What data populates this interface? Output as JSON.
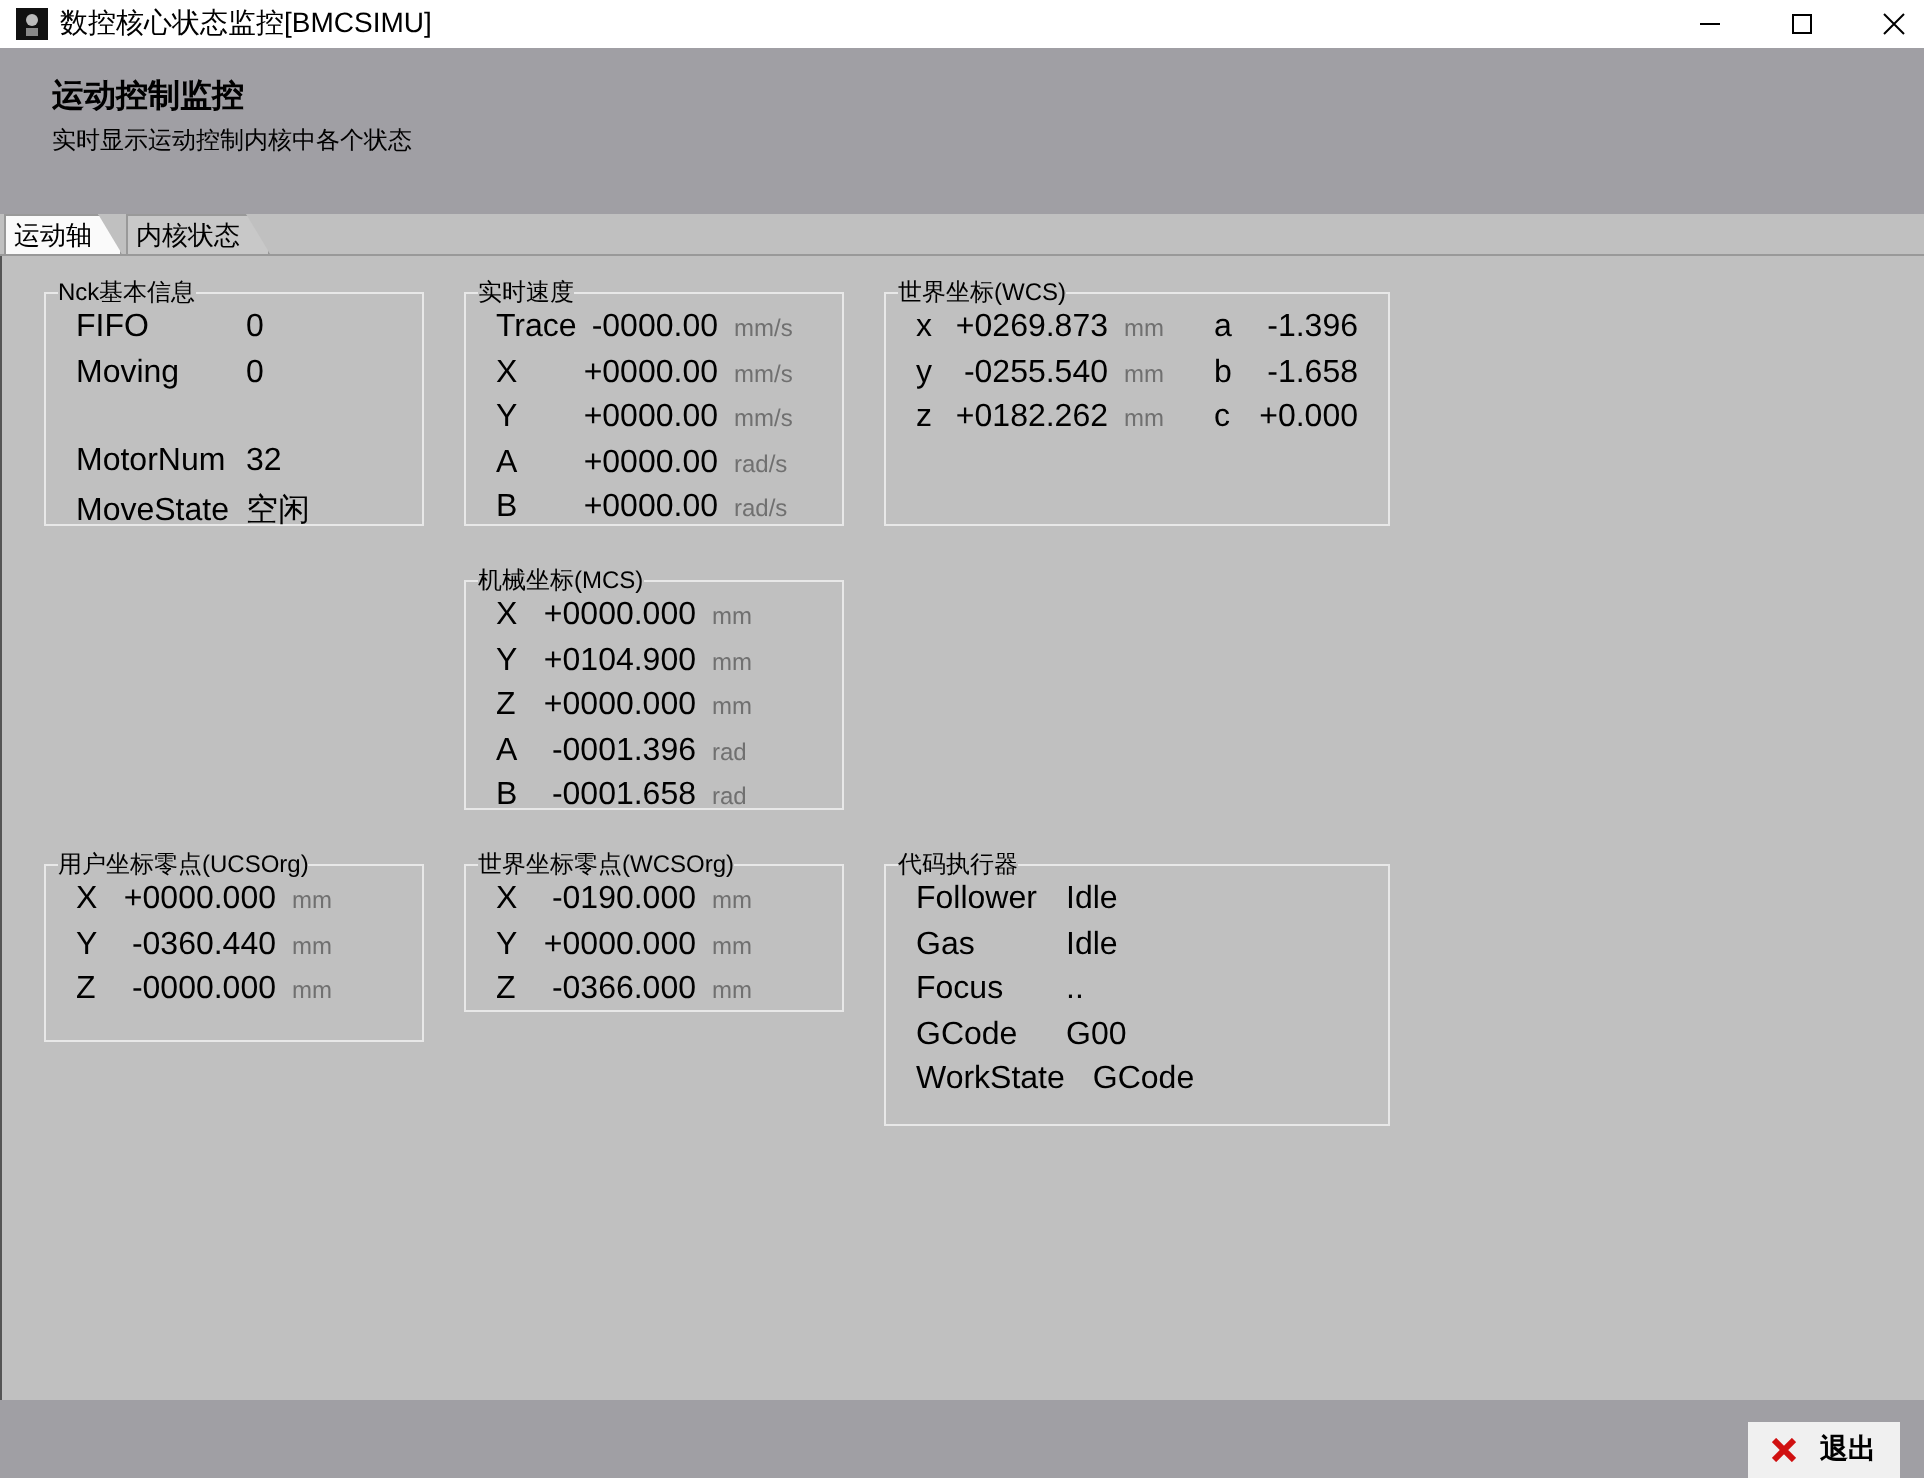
{
  "window": {
    "title": "数控核心状态监控[BMCSIMU]"
  },
  "header": {
    "title": "运动控制监控",
    "subtitle": "实时显示运动控制内核中各个状态"
  },
  "tabs": [
    {
      "label": "运动轴",
      "selected": true
    },
    {
      "label": "内核状态",
      "selected": false
    }
  ],
  "panels": [
    {
      "title": "Nck基本信息",
      "kind": "info",
      "rows": [
        {
          "label": "FIFO",
          "value": "0"
        },
        {
          "label": "Moving",
          "value": "0"
        }
      ],
      "rows_2": [
        {
          "label": "MotorNum",
          "value": "32"
        },
        {
          "label": "MoveState",
          "value": "空闲"
        }
      ]
    },
    {
      "title": "实时速度",
      "kind": "speed",
      "rows": [
        {
          "label": "Trace",
          "value": "-0000.00",
          "unit": "mm/s"
        },
        {
          "label": "X",
          "value": "+0000.00",
          "unit": "mm/s"
        },
        {
          "label": "Y",
          "value": "+0000.00",
          "unit": "mm/s"
        },
        {
          "label": "A",
          "value": "+0000.00",
          "unit": "rad/s"
        },
        {
          "label": "B",
          "value": "+0000.00",
          "unit": "rad/s"
        }
      ]
    },
    {
      "title": "世界坐标(WCS)",
      "kind": "dual",
      "rows": [
        {
          "label": "x",
          "value": "+0269.873",
          "unit": "mm",
          "label_2": "a",
          "value_2": "-1.396"
        },
        {
          "label": "y",
          "value": "-0255.540",
          "unit": "mm",
          "label_2": "b",
          "value_2": "-1.658"
        },
        {
          "label": "z",
          "value": "+0182.262",
          "unit": "mm",
          "label_2": "c",
          "value_2": "+0.000"
        }
      ]
    },
    {
      "title": "机械坐标(MCS)",
      "kind": "coord",
      "rows": [
        {
          "label": "X",
          "value": "+0000.000",
          "unit": "mm"
        },
        {
          "label": "Y",
          "value": "+0104.900",
          "unit": "mm"
        },
        {
          "label": "Z",
          "value": "+0000.000",
          "unit": "mm"
        },
        {
          "label": "A",
          "value": "-0001.396",
          "unit": "rad"
        },
        {
          "label": "B",
          "value": "-0001.658",
          "unit": "rad"
        }
      ]
    },
    {
      "title": "用户坐标零点(UCSOrg)",
      "kind": "coord",
      "rows": [
        {
          "label": "X",
          "value": "+0000.000",
          "unit": "mm"
        },
        {
          "label": "Y",
          "value": "-0360.440",
          "unit": "mm"
        },
        {
          "label": "Z",
          "value": "-0000.000",
          "unit": "mm"
        }
      ]
    },
    {
      "title": "世界坐标零点(WCSOrg)",
      "kind": "coord",
      "rows": [
        {
          "label": "X",
          "value": "-0190.000",
          "unit": "mm"
        },
        {
          "label": "Y",
          "value": "+0000.000",
          "unit": "mm"
        },
        {
          "label": "Z",
          "value": "-0366.000",
          "unit": "mm"
        }
      ]
    },
    {
      "title": "代码执行器",
      "kind": "exec",
      "rows": [
        {
          "label": "Follower",
          "value": "Idle"
        },
        {
          "label": "Gas",
          "value": "Idle"
        },
        {
          "label": "Focus",
          "value": ".."
        },
        {
          "label": "GCode",
          "value": "G00"
        },
        {
          "label": "WorkState",
          "value": "GCode"
        }
      ]
    }
  ],
  "footer": {
    "exit_button": "退出"
  }
}
